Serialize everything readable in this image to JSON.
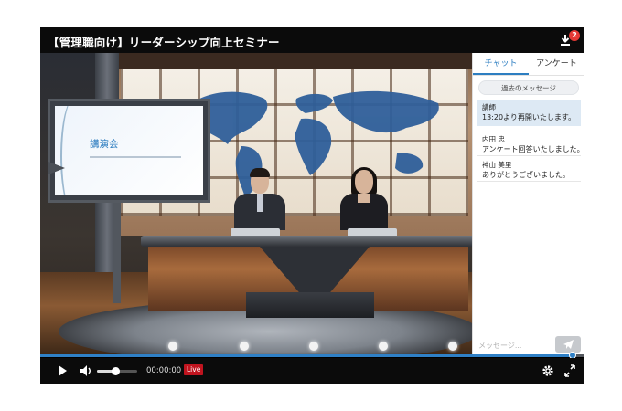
{
  "header": {
    "title": "【管理職向け】リーダーシップ向上セミナー",
    "download_badge": "2"
  },
  "video": {
    "slide_title": "講演会"
  },
  "panel": {
    "tabs": [
      {
        "label": "チャット",
        "active": true
      },
      {
        "label": "アンケート",
        "active": false
      }
    ],
    "past_messages_button": "過去のメッセージ",
    "messages": [
      {
        "name": "講師",
        "text": "13:20より再開いたします。",
        "highlighted": true
      },
      {
        "name": "内田 忠",
        "text": "アンケート回答いたしました。",
        "highlighted": false
      },
      {
        "name": "神山 美里",
        "text": "ありがとうございました。",
        "highlighted": false
      }
    ],
    "input_placeholder": "メッセージ...",
    "send_icon": "paper-plane-icon"
  },
  "controls": {
    "time": "00:00:00",
    "live_label": "Live",
    "progress_fraction": 0.98,
    "volume_fraction": 0.45,
    "icons": [
      "play-icon",
      "volume-icon",
      "gear-icon",
      "fullscreen-icon",
      "download-icon"
    ]
  },
  "colors": {
    "accent": "#2d7ec1",
    "live": "#c0141f",
    "highlight": "#dde9f4",
    "bar": "#0b0b0b"
  }
}
